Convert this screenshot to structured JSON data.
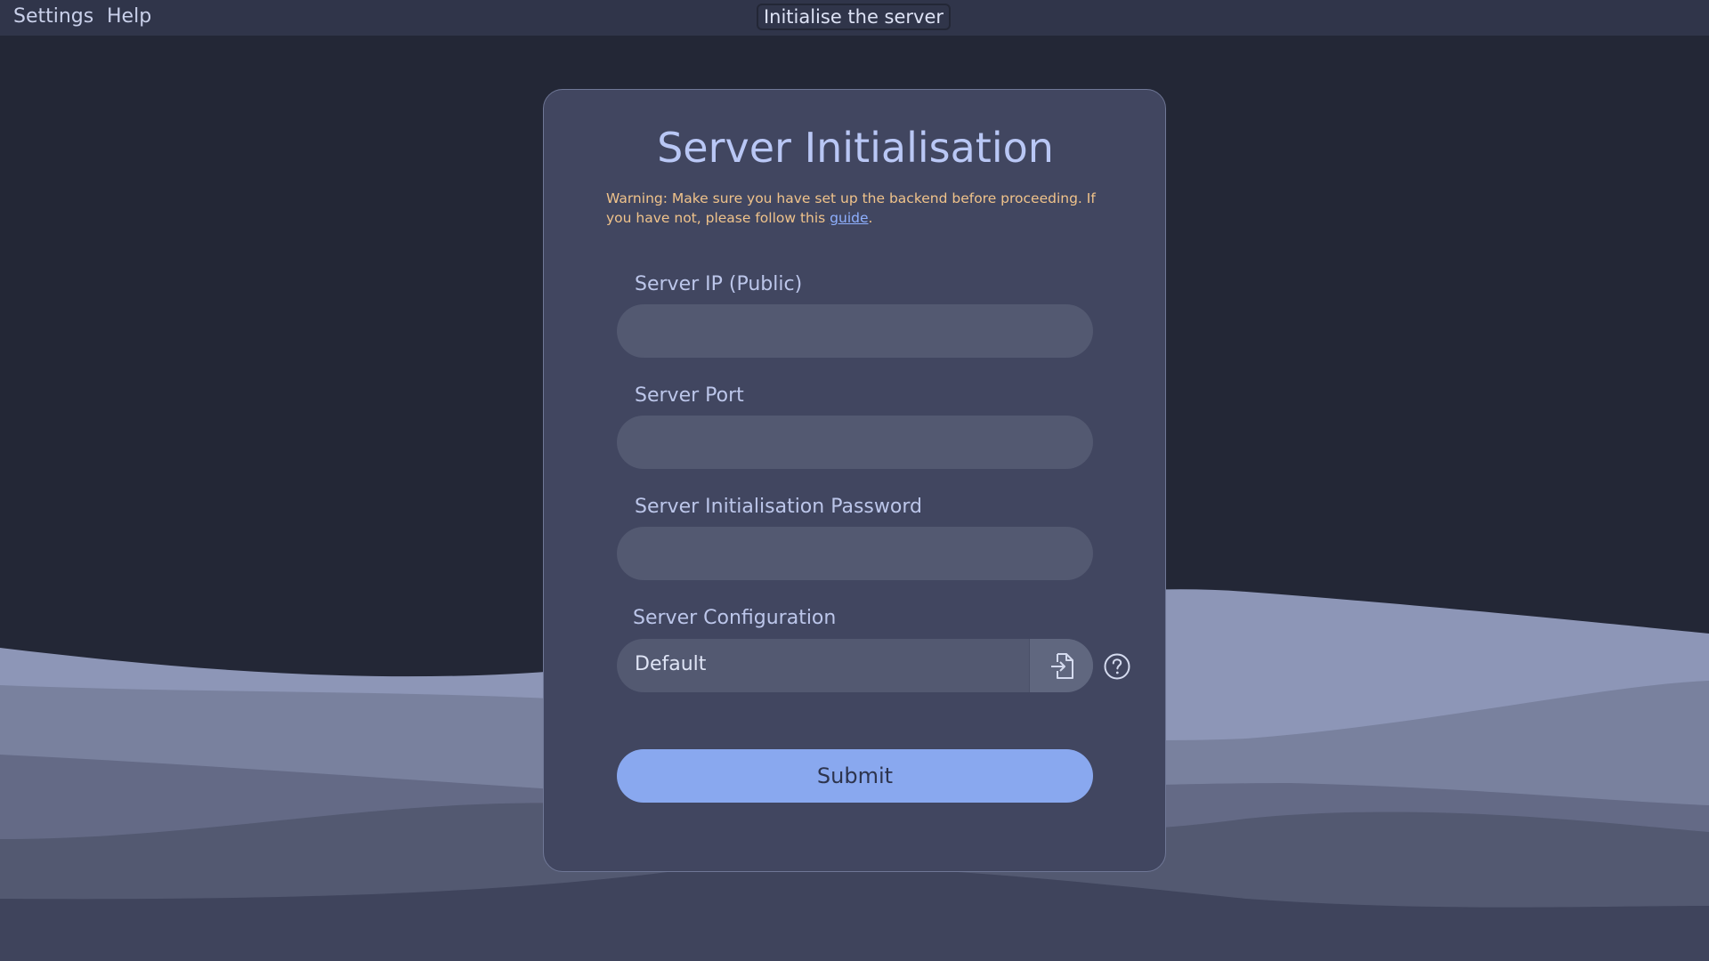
{
  "menubar": {
    "settings_label": "Settings",
    "help_label": "Help",
    "window_title": "Initialise the server"
  },
  "form": {
    "title": "Server Initialisation",
    "warning_text": "Warning: Make sure you have set up the backend before proceeding. If you have not, please follow this ",
    "warning_link": "guide",
    "warning_end": ".",
    "fields": [
      {
        "label": "Server IP (Public)",
        "value": ""
      },
      {
        "label": "Server Port",
        "value": ""
      },
      {
        "label": "Server Initialisation Password",
        "value": ""
      }
    ],
    "config": {
      "label": "Server Configuration",
      "value": "Default",
      "file_icon": "file-import-icon",
      "help_icon": "help-circle-icon"
    },
    "submit_label": "Submit"
  },
  "colors": {
    "background": "#232736",
    "menubar": "#30354a",
    "card": "#414660",
    "input": "#535971",
    "accent": "#89a8ef",
    "warning": "#f0c38b",
    "title": "#b9c7f5"
  }
}
